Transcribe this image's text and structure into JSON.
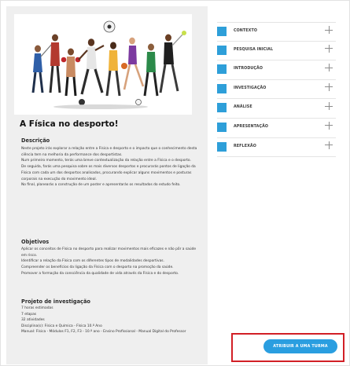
{
  "project": {
    "title": "A Física no desporto!"
  },
  "description": {
    "heading": "Descrição",
    "paragraphs": [
      "Neste projeto irás explorar a relação entre a Física e desporto e o impacto que o conhecimento desta ciência tem na melhoria da performance dos desportistas.",
      "Num primeiro momento, terás uma breve contextualização da relação entre a Física e o desporto.",
      "De seguida, farás uma pesquisa sobre os mais diversos desportos e procurarás pontos de ligação da Física com cada um dos desportos analisados, procurando explicar alguns movimentos e posturas corporais na execução do movimento ideal.",
      "No final, planearás a construção de um poster e apresentarás os resultados do estudo feito."
    ]
  },
  "objectives": {
    "heading": "Objetivos",
    "paragraphs": [
      "Aplicar os conceitos de Física no desporto para realizar movimentos mais eficazes e não pôr a saúde em risco.",
      "Identificar a relação da Física com os diferentes tipos de modalidades desportivas.",
      "Compreender os benefícios da ligação da Física com o desporto na promoção da saúde.",
      "Promover a formação da consciência da qualidade de vida através da Física e do desporto."
    ]
  },
  "investigation": {
    "heading": "Projeto de investigação",
    "hours": "7 horas estimadas",
    "stages": "7 etapas",
    "activities": "32 atividades",
    "subjects": "Disciplina(s): Física e Química - Física 10.º Ano",
    "manuals": "Manual: Física - Módulos F1, F2, F3 - 10.º ano - Ensino Profissional - Manual Digital do Professor"
  },
  "menu": {
    "items": [
      {
        "label": "CONTEXTO"
      },
      {
        "label": "PESQUISA INICIAL"
      },
      {
        "label": "INTRODUÇÃO"
      },
      {
        "label": "INVESTIGAÇÃO"
      },
      {
        "label": "ANÁLISE"
      },
      {
        "label": "APRESENTAÇÃO"
      },
      {
        "label": "REFLEXÃO"
      }
    ]
  },
  "actions": {
    "assign_label": "ATRIBUIR A UMA TURMA"
  },
  "colors": {
    "accent": "#2e9fd9",
    "button": "#2a9ee0",
    "highlight": "#d21f26",
    "panel": "#efefef"
  },
  "icons": {
    "menu_expand": "plus-icon"
  }
}
